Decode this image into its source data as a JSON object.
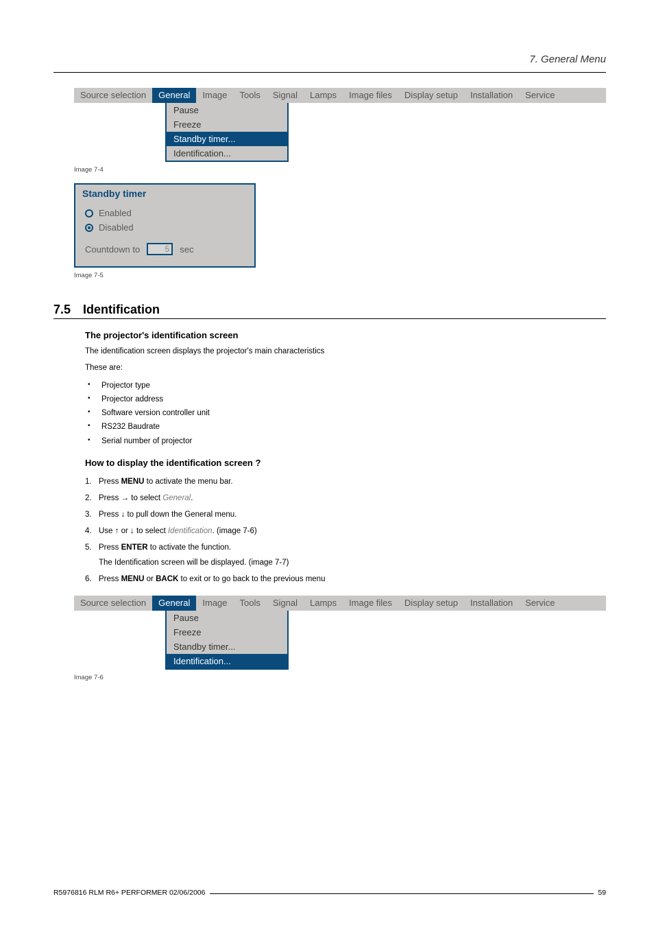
{
  "header": {
    "chapter": "7. General Menu"
  },
  "menubar_tabs": [
    "Source selection",
    "General",
    "Image",
    "Tools",
    "Signal",
    "Lamps",
    "Image files",
    "Display setup",
    "Installation",
    "Service"
  ],
  "menubar_active_index": 1,
  "dropdown_items": [
    "Pause",
    "Freeze",
    "Standby timer...",
    "Identification..."
  ],
  "img74": {
    "selected_index": 2,
    "caption": "Image 7-4"
  },
  "dialog": {
    "title": "Standby timer",
    "opt_enabled": "Enabled",
    "opt_disabled": "Disabled",
    "countdown_label": "Countdown to",
    "countdown_value": "5",
    "countdown_unit": "sec"
  },
  "img75_caption": "Image 7-5",
  "section": {
    "num": "7.5",
    "title": "Identification"
  },
  "ident": {
    "h1": "The projector's identification screen",
    "p1": "The identification screen displays the projector's main characteristics",
    "p2": "These are:",
    "bullets": [
      "Projector type",
      "Projector address",
      "Software version controller unit",
      "RS232 Baudrate",
      "Serial number of projector"
    ],
    "h2": "How to display the identification screen ?",
    "steps": {
      "s1a": "Press ",
      "s1b": "MENU",
      "s1c": " to activate the menu bar.",
      "s2a": "Press → to select ",
      "s2b": "General",
      "s2c": ".",
      "s3": "Press ↓ to pull down the General menu.",
      "s4a": "Use ↑ or ↓ to select ",
      "s4b": "Identification",
      "s4c": ". (image 7-6)",
      "s5a": "Press ",
      "s5b": "ENTER",
      "s5c": " to activate the function.",
      "s5sub": "The Identification screen will be displayed. (image 7-7)",
      "s6a": "Press ",
      "s6b": "MENU",
      "s6c": " or ",
      "s6d": "BACK",
      "s6e": " to exit or to go back to the previous menu"
    }
  },
  "img76": {
    "selected_index": 3,
    "caption": "Image 7-6"
  },
  "footer": {
    "left": "R5976816 RLM R6+ PERFORMER 02/06/2006",
    "right": "59"
  }
}
